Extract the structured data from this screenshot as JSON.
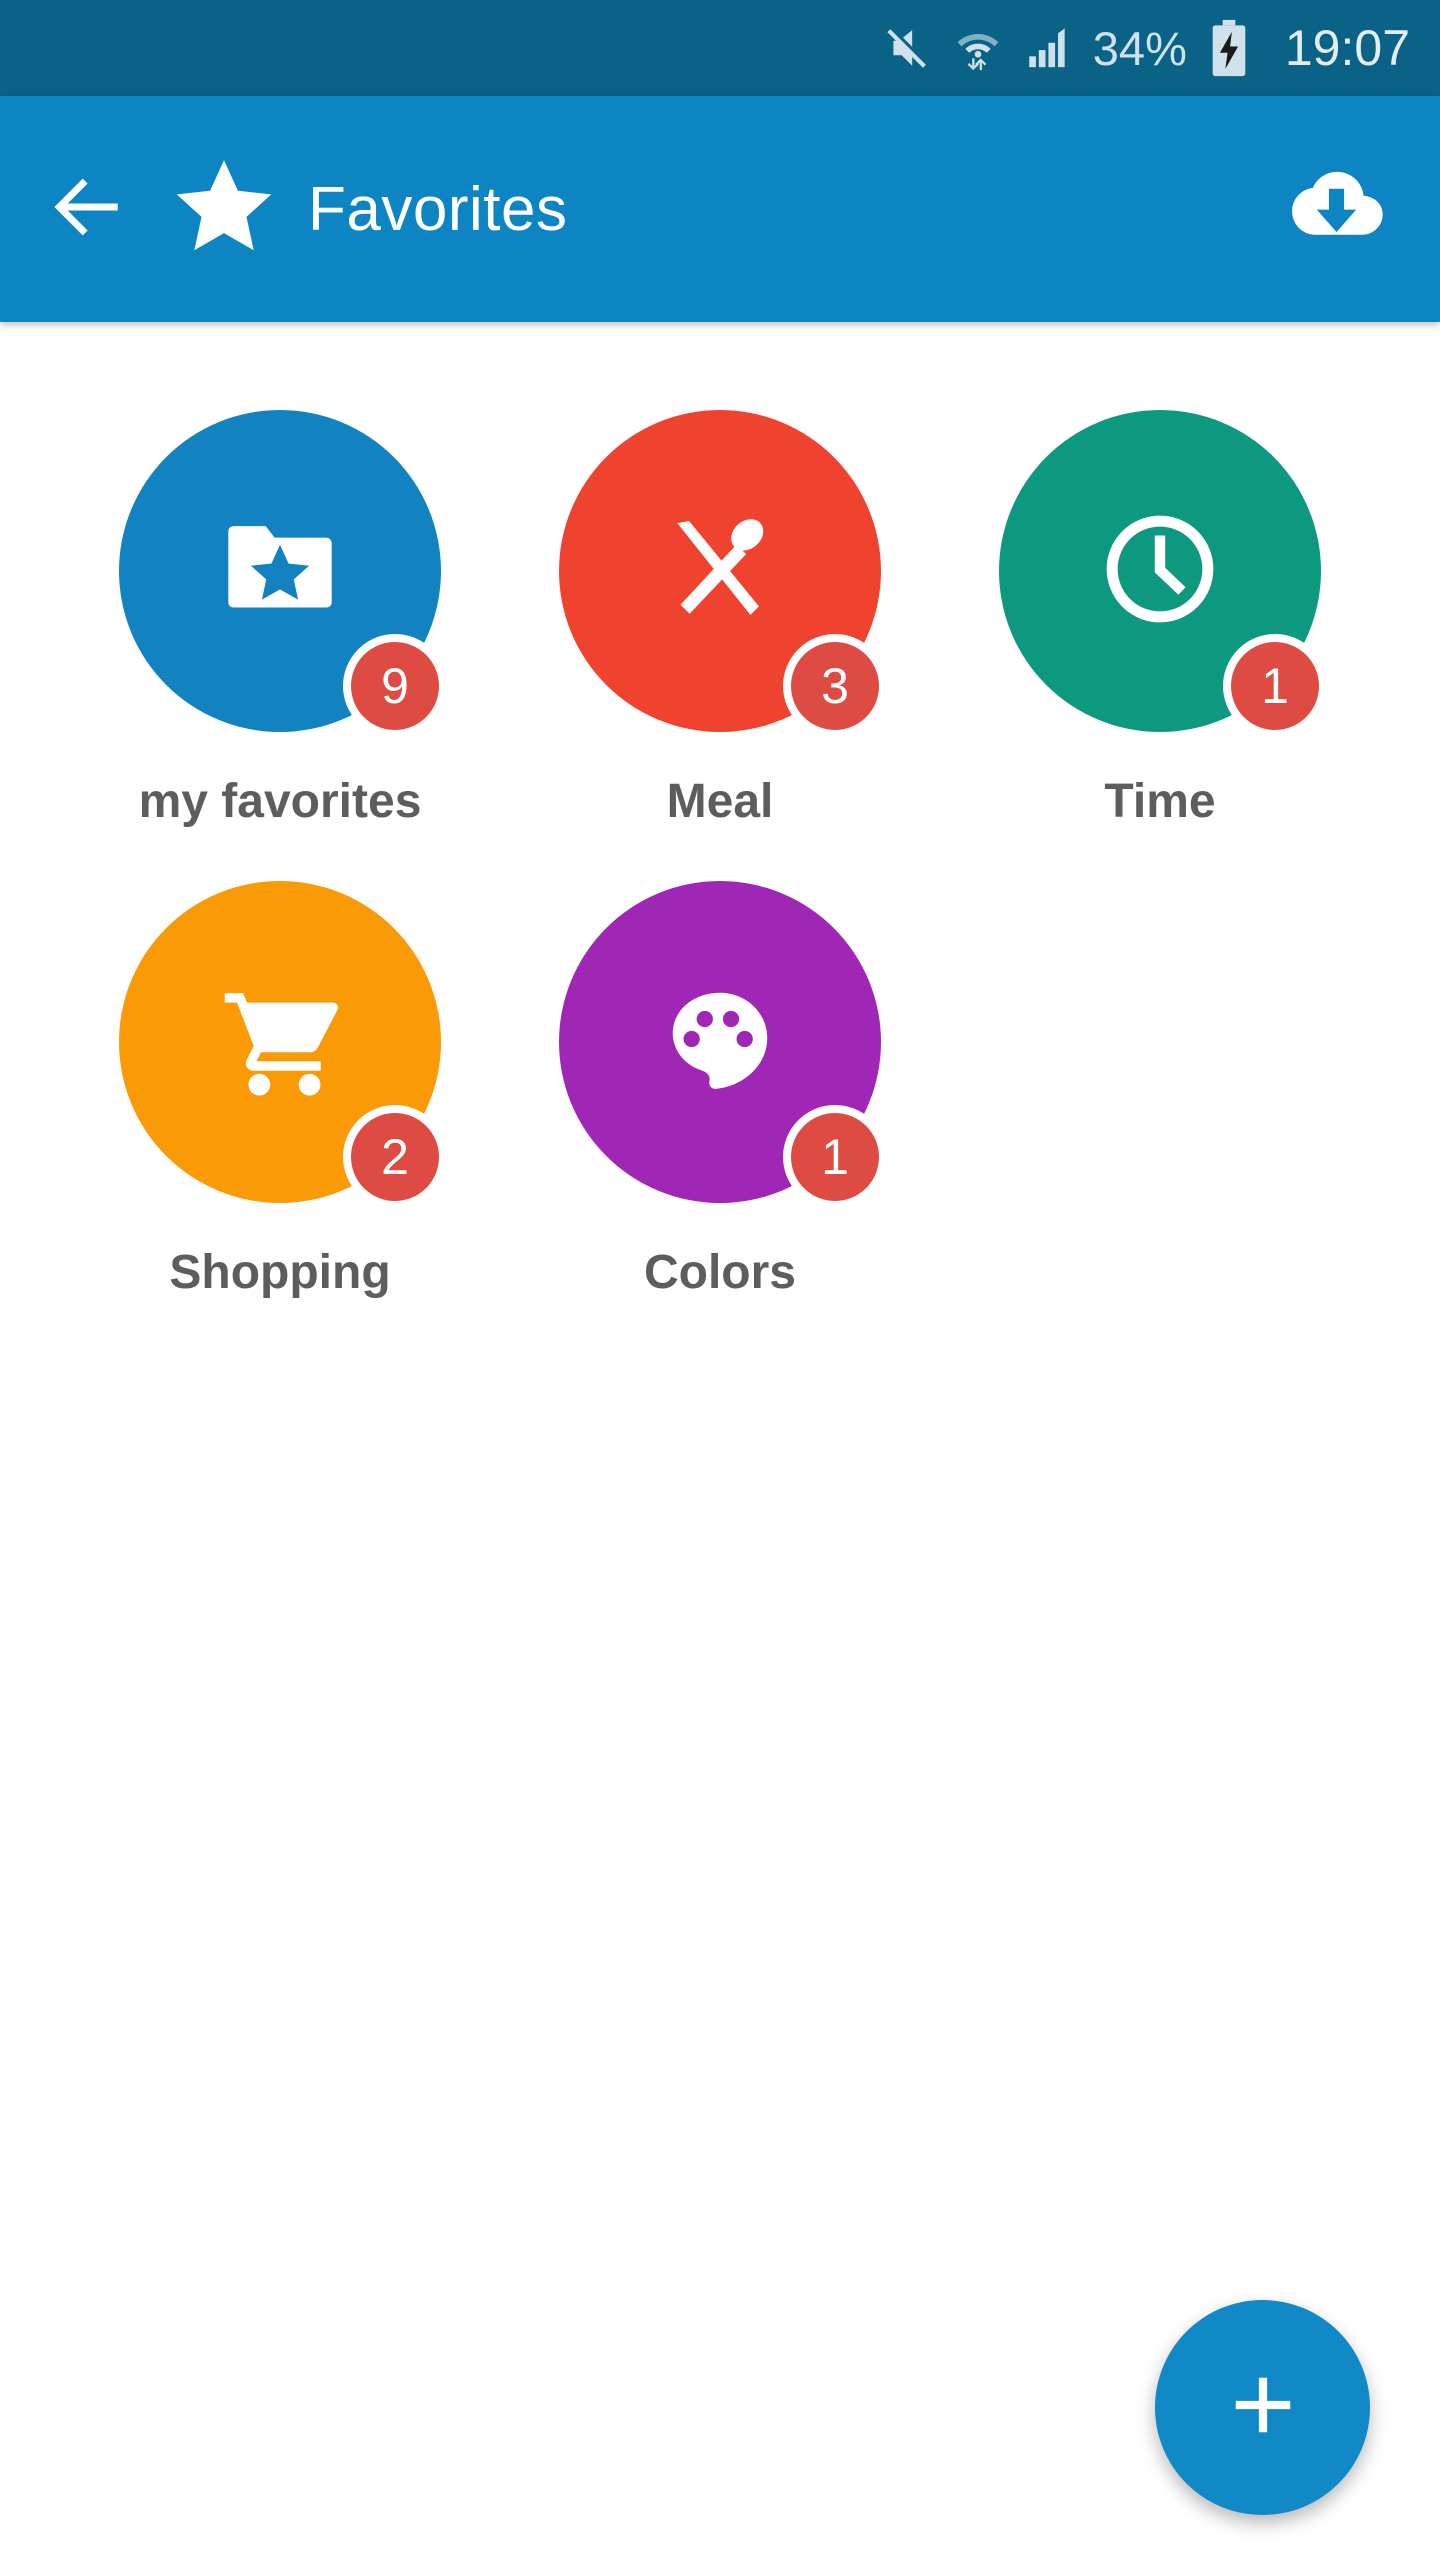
{
  "statusbar": {
    "icons": [
      "mute-icon",
      "wifi-icon",
      "cellular-signal-icon",
      "battery-charging-icon"
    ],
    "battery_percent": "34%",
    "time": "19:07",
    "bg_color": "#0a6287",
    "fg_color": "#cfe2ec"
  },
  "appbar": {
    "back_label": "back-arrow",
    "star_label": "star",
    "title": "Favorites",
    "download_label": "cloud-download",
    "bg_color": "#0d85c2",
    "fg_color": "#ffffff"
  },
  "grid": {
    "tiles": [
      {
        "label": "my favorites",
        "badge": "9",
        "color": "#1283c0",
        "icon": "folder-star-icon"
      },
      {
        "label": "Meal",
        "badge": "3",
        "color": "#f0432f",
        "icon": "cutlery-icon"
      },
      {
        "label": "Time",
        "badge": "1",
        "color": "#0d9980",
        "icon": "clock-icon"
      },
      {
        "label": "Shopping",
        "badge": "2",
        "color": "#f99a06",
        "icon": "shopping-cart-icon"
      },
      {
        "label": "Colors",
        "badge": "1",
        "color": "#a026b5",
        "icon": "palette-icon"
      }
    ],
    "badge_color": "#dd4b43",
    "label_color": "#5d5d5d"
  },
  "fab": {
    "label": "add",
    "color": "#1189c6"
  }
}
